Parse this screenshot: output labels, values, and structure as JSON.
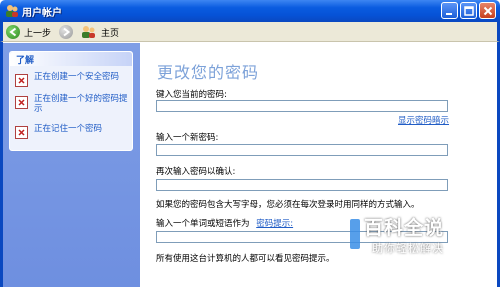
{
  "window": {
    "title": "用户帐户",
    "colors": {
      "titlebar": "#0a5ce0",
      "sidebar": "#7f9ee6",
      "link": "#215dc6",
      "heading": "#7da2d9"
    }
  },
  "toolbar": {
    "back_label": "上一步",
    "home_label": "主页"
  },
  "sidebar": {
    "heading": "了解",
    "items": [
      {
        "label": "正在创建一个安全密码",
        "icon": "help-topic-icon"
      },
      {
        "label": "正在创建一个好的密码提示",
        "icon": "help-topic-icon"
      },
      {
        "label": "正在记住一个密码",
        "icon": "help-topic-icon"
      }
    ]
  },
  "main": {
    "title": "更改您的密码",
    "current_password_label": "键入您当前的密码:",
    "current_password_value": "",
    "show_hint_link": "显示密码暗示",
    "new_password_label": "输入一个新密码:",
    "new_password_value": "",
    "confirm_password_label": "再次输入密码以确认:",
    "confirm_password_value": "",
    "caps_note": "如果您的密码包含大写字母，您必须在每次登录时用同样的方式输入。",
    "hint_label": "输入一个单词或短语作为",
    "hint_link": "密码提示:",
    "hint_value": "",
    "visibility_note": "所有使用这台计算机的人都可以看见密码提示。"
  },
  "watermark": {
    "main": "百科全说",
    "sub": "助你轻松解决"
  }
}
